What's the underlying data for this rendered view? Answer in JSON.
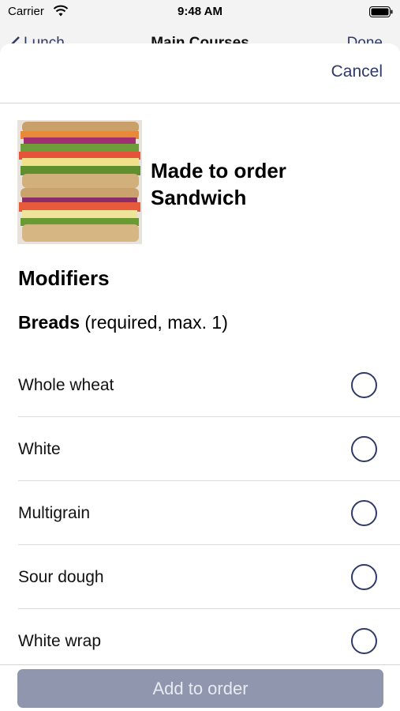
{
  "status_bar": {
    "carrier": "Carrier",
    "time": "9:48 AM"
  },
  "background_nav": {
    "back_label": "Lunch",
    "title": "Main Courses",
    "done_label": "Done"
  },
  "sheet": {
    "cancel_label": "Cancel",
    "product": {
      "title": "Made to order Sandwich",
      "image_icon": "sandwich-photo"
    },
    "section_title": "Modifiers",
    "group": {
      "name": "Breads",
      "rule": "(required, max. 1)",
      "options": [
        {
          "label": "Whole wheat",
          "selected": false
        },
        {
          "label": "White",
          "selected": false
        },
        {
          "label": "Multigrain",
          "selected": false
        },
        {
          "label": "Sour dough",
          "selected": false
        },
        {
          "label": "White wrap",
          "selected": false
        }
      ]
    },
    "add_button_label": "Add to order"
  },
  "colors": {
    "accent": "#2f3a66",
    "disabled_button": "#8f96ad"
  }
}
